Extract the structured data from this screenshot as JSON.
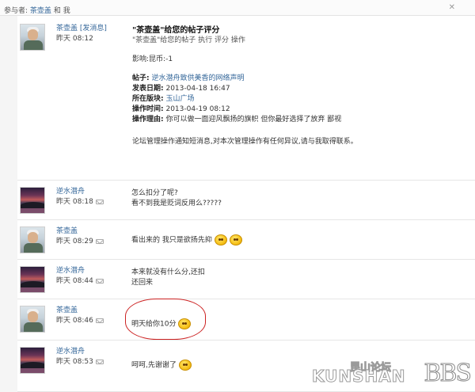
{
  "header": {
    "participants_label": "参与者:",
    "participant_1": "茶壶盖",
    "and_label": "和",
    "participant_2": "我",
    "close_label": "✕"
  },
  "system_message": {
    "sender": "茶壶盖",
    "sender_tag": "[发消息]",
    "time": "昨天 08:12",
    "title": "\"茶壶盖\"给您的帖子评分",
    "subtitle": "\"茶壶盖\"给您的帖子 执行 评分 操作",
    "impact_label": "影响:",
    "impact_value": "昆币:-1",
    "post_label": "帖子:",
    "post_title": "逆水潜舟致供美香的网络声明",
    "published_label": "发表日期:",
    "published_value": "2013-04-18 16:47",
    "forum_label": "所在版块:",
    "forum_value": "玉山广场",
    "op_time_label": "操作时间:",
    "op_time_value": "2013-04-19 08:12",
    "reason_label": "操作理由:",
    "reason_value": "你可以做一面迎风飘扬的旗帜 但你最好选择了放弃 鄙视",
    "notice": "论坛管理操作通知短消息,对本次管理操作有任何异议,请与我取得联系。"
  },
  "messages": [
    {
      "sender": "逆水潜舟",
      "time": "昨天 08:18",
      "avatar": "sunset",
      "lines": [
        "怎么扣分了呢?",
        "看不到我是贬词反用么?????"
      ],
      "emoji": 0
    },
    {
      "sender": "茶壶盖",
      "time": "昨天 08:29",
      "avatar": "person",
      "lines": [
        "看出来的 我只是欲扬先抑"
      ],
      "emoji": 2
    },
    {
      "sender": "逆水潜舟",
      "time": "昨天 08:44",
      "avatar": "sunset",
      "lines": [
        "本来就没有什么分,还扣",
        "还回来"
      ],
      "emoji": 0
    },
    {
      "sender": "茶壶盖",
      "time": "昨天 08:46",
      "avatar": "person",
      "lines": [
        "明天给你10分"
      ],
      "emoji": 1
    },
    {
      "sender": "逆水潜舟",
      "time": "昨天 08:53",
      "avatar": "sunset",
      "lines": [
        "呵呵,先谢谢了"
      ],
      "emoji": 1
    }
  ],
  "watermark": {
    "latin": "KUNSHAN",
    "chinese": "昆山论坛",
    "bbs": "BBS"
  }
}
